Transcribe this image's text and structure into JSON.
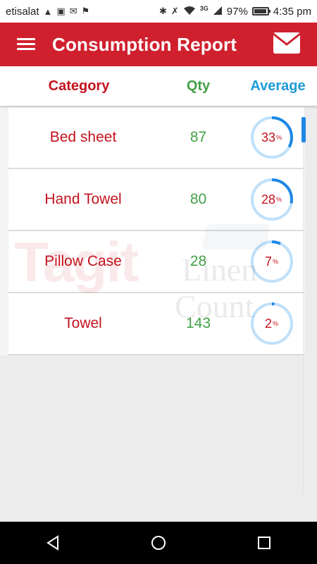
{
  "status_bar": {
    "carrier": "etisalat",
    "network": "3G",
    "battery": "97%",
    "time": "4:35 pm"
  },
  "app_bar": {
    "title": "Consumption Report",
    "menu_icon": "hamburger-menu-icon",
    "mail_icon": "mail-icon"
  },
  "table": {
    "headers": {
      "category": "Category",
      "qty": "Qty",
      "average": "Average"
    },
    "rows": [
      {
        "category": "Bed sheet",
        "qty": "87",
        "average": "33",
        "average_value": 33
      },
      {
        "category": "Hand Towel",
        "qty": "80",
        "average": "28",
        "average_value": 28
      },
      {
        "category": "Pillow Case",
        "qty": "28",
        "average": "7",
        "average_value": 7
      },
      {
        "category": "Towel",
        "qty": "143",
        "average": "2",
        "average_value": 2
      }
    ],
    "percent_sign": "%"
  },
  "watermark": {
    "brand": "Tagit",
    "line1": "Linen",
    "line2": "Count"
  },
  "colors": {
    "app_bar": "#d0202e",
    "category_text": "#c3131e",
    "qty_text": "#43a047",
    "average_header": "#1e9bd7",
    "ring_track": "#bfe0fa",
    "ring_progress": "#1e88e5"
  },
  "nav_bar": {
    "back_icon": "back-triangle-icon",
    "home_icon": "home-circle-icon",
    "recents_icon": "recents-square-icon"
  }
}
